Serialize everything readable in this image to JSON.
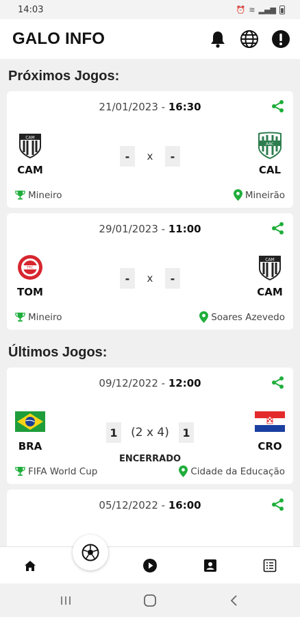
{
  "status_bar": {
    "time": "14:03"
  },
  "app": {
    "title": "GALO INFO"
  },
  "sections": {
    "upcoming_title": "Próximos Jogos:",
    "recent_title": "Últimos Jogos:"
  },
  "upcoming": [
    {
      "date": "21/01/2023",
      "time": "16:30",
      "separator": " - ",
      "home": "CAM",
      "away": "CAL",
      "home_score": "-",
      "away_score": "-",
      "vs": "x",
      "competition": "Mineiro",
      "venue": "Mineirão"
    },
    {
      "date": "29/01/2023",
      "time": "11:00",
      "separator": " - ",
      "home": "TOM",
      "away": "CAM",
      "home_score": "-",
      "away_score": "-",
      "vs": "x",
      "competition": "Mineiro",
      "venue": "Soares Azevedo"
    }
  ],
  "recent": [
    {
      "date": "09/12/2022",
      "time": "12:00",
      "separator": " - ",
      "home": "BRA",
      "away": "CRO",
      "home_score": "1",
      "away_score": "1",
      "penalties": "(2 x 4)",
      "status": "ENCERRADO",
      "competition": "FIFA World Cup",
      "venue": "Cidade da Educação"
    },
    {
      "date": "05/12/2022",
      "time": "16:00",
      "separator": " - "
    }
  ],
  "colors": {
    "accent_green": "#1fae3b",
    "text_dark": "#111111"
  },
  "icons": {
    "header": [
      "bell-icon",
      "globe-icon",
      "info-icon"
    ],
    "nav": [
      "home-icon",
      "soccer-ball-icon",
      "play-icon",
      "contact-card-icon",
      "list-icon"
    ]
  }
}
